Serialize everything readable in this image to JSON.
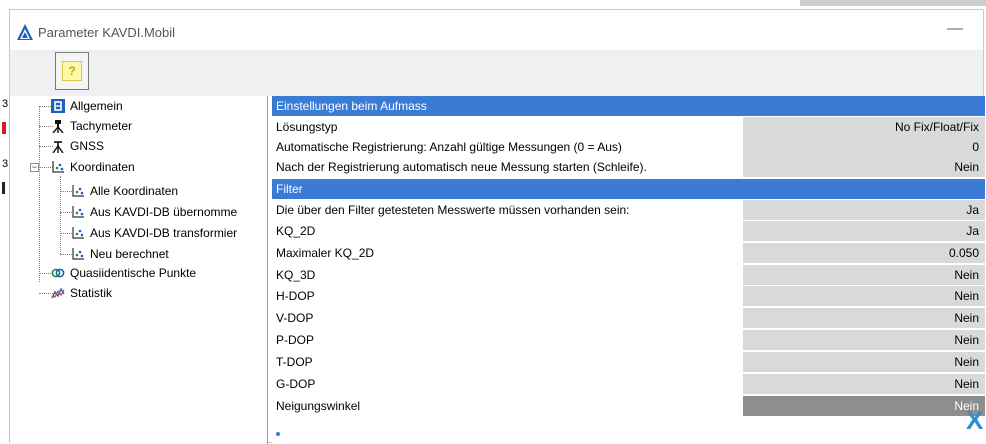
{
  "window": {
    "title": "Parameter KAVDI.Mobil",
    "minimize_glyph": "—"
  },
  "toolbar": {
    "help_icon": "help-icon",
    "help_glyph": "?"
  },
  "tree": {
    "items": [
      {
        "label": "Allgemein",
        "icon": "allgemein-icon"
      },
      {
        "label": "Tachymeter",
        "icon": "tachymeter-icon"
      },
      {
        "label": "GNSS",
        "icon": "gnss-icon",
        "selected": true
      },
      {
        "label": "Koordinaten",
        "icon": "coordinates-icon",
        "expanded": true
      },
      {
        "label": "Alle Koordinaten",
        "icon": "coordinates-icon"
      },
      {
        "label": "Aus KAVDI-DB übernomme",
        "icon": "coordinates-icon"
      },
      {
        "label": "Aus KAVDI-DB transformier",
        "icon": "coordinates-icon"
      },
      {
        "label": "Neu berechnet",
        "icon": "coordinates-icon"
      },
      {
        "label": "Quasiidentische Punkte",
        "icon": "quasi-identical-icon"
      },
      {
        "label": "Statistik",
        "icon": "statistics-icon"
      }
    ],
    "expander_glyph": "−"
  },
  "grid": {
    "section1": "Einstellungen beim Aufmass",
    "rows1": [
      {
        "name": "Lösungstyp",
        "value": "No Fix/Float/Fix"
      },
      {
        "name": "Automatische Registrierung: Anzahl gültige Messungen (0 = Aus)",
        "value": "0"
      },
      {
        "name": "Nach der Registrierung automatisch neue Messung starten (Schleife).",
        "value": "Nein"
      }
    ],
    "section2": "Filter",
    "rows2": [
      {
        "name": "Die über den Filter getesteten Messwerte müssen vorhanden sein:",
        "value": "Ja"
      },
      {
        "name": "KQ_2D",
        "value": "Ja"
      },
      {
        "name": "Maximaler KQ_2D",
        "value": "0.050"
      },
      {
        "name": "KQ_3D",
        "value": "Nein"
      },
      {
        "name": "H-DOP",
        "value": "Nein"
      },
      {
        "name": "V-DOP",
        "value": "Nein"
      },
      {
        "name": "P-DOP",
        "value": "Nein"
      },
      {
        "name": "T-DOP",
        "value": "Nein"
      },
      {
        "name": "G-DOP",
        "value": "Nein"
      },
      {
        "name": "Neigungswinkel",
        "value": "Nein",
        "highlighted": true
      }
    ]
  },
  "overlay": {
    "close_glyph": "X"
  },
  "colors": {
    "section_header": "#3a7bd5",
    "value_cell": "#d9d9d9",
    "value_cell_selected": "#8e8e8e",
    "close_mark": "#2f8fcf"
  }
}
